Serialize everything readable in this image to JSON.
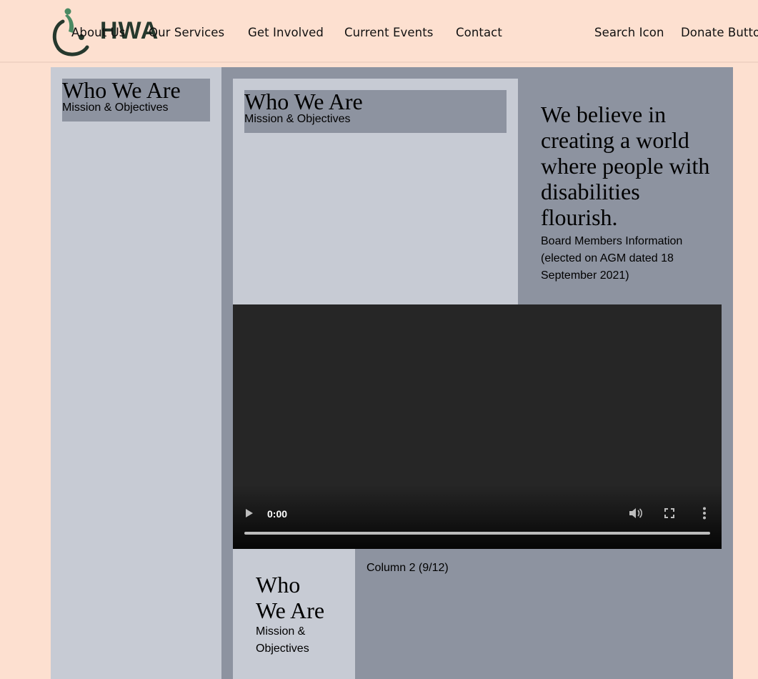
{
  "header": {
    "logo_text": "HWA",
    "nav": [
      "About Us",
      "Our Services",
      "Get Involved",
      "Current Events",
      "Contact"
    ],
    "search_label": "Search Icon",
    "donate_label": "Donate Button"
  },
  "sidebar": {
    "title": "Who We Are",
    "subtitle": "Mission & Objectives"
  },
  "main": {
    "title": "Who We Are",
    "subtitle": "Mission & Objectives",
    "belief": "We believe in creating a world where people with disabilities flourish.",
    "board_info": "Board Members Information (elected on AGM dated 18 September 2021)"
  },
  "video": {
    "time": "0:00",
    "progress": 0
  },
  "bottom": {
    "title": "Who We Are",
    "subtitle": "Mission & Objectives",
    "column2": "Column 2 (9/12)"
  }
}
